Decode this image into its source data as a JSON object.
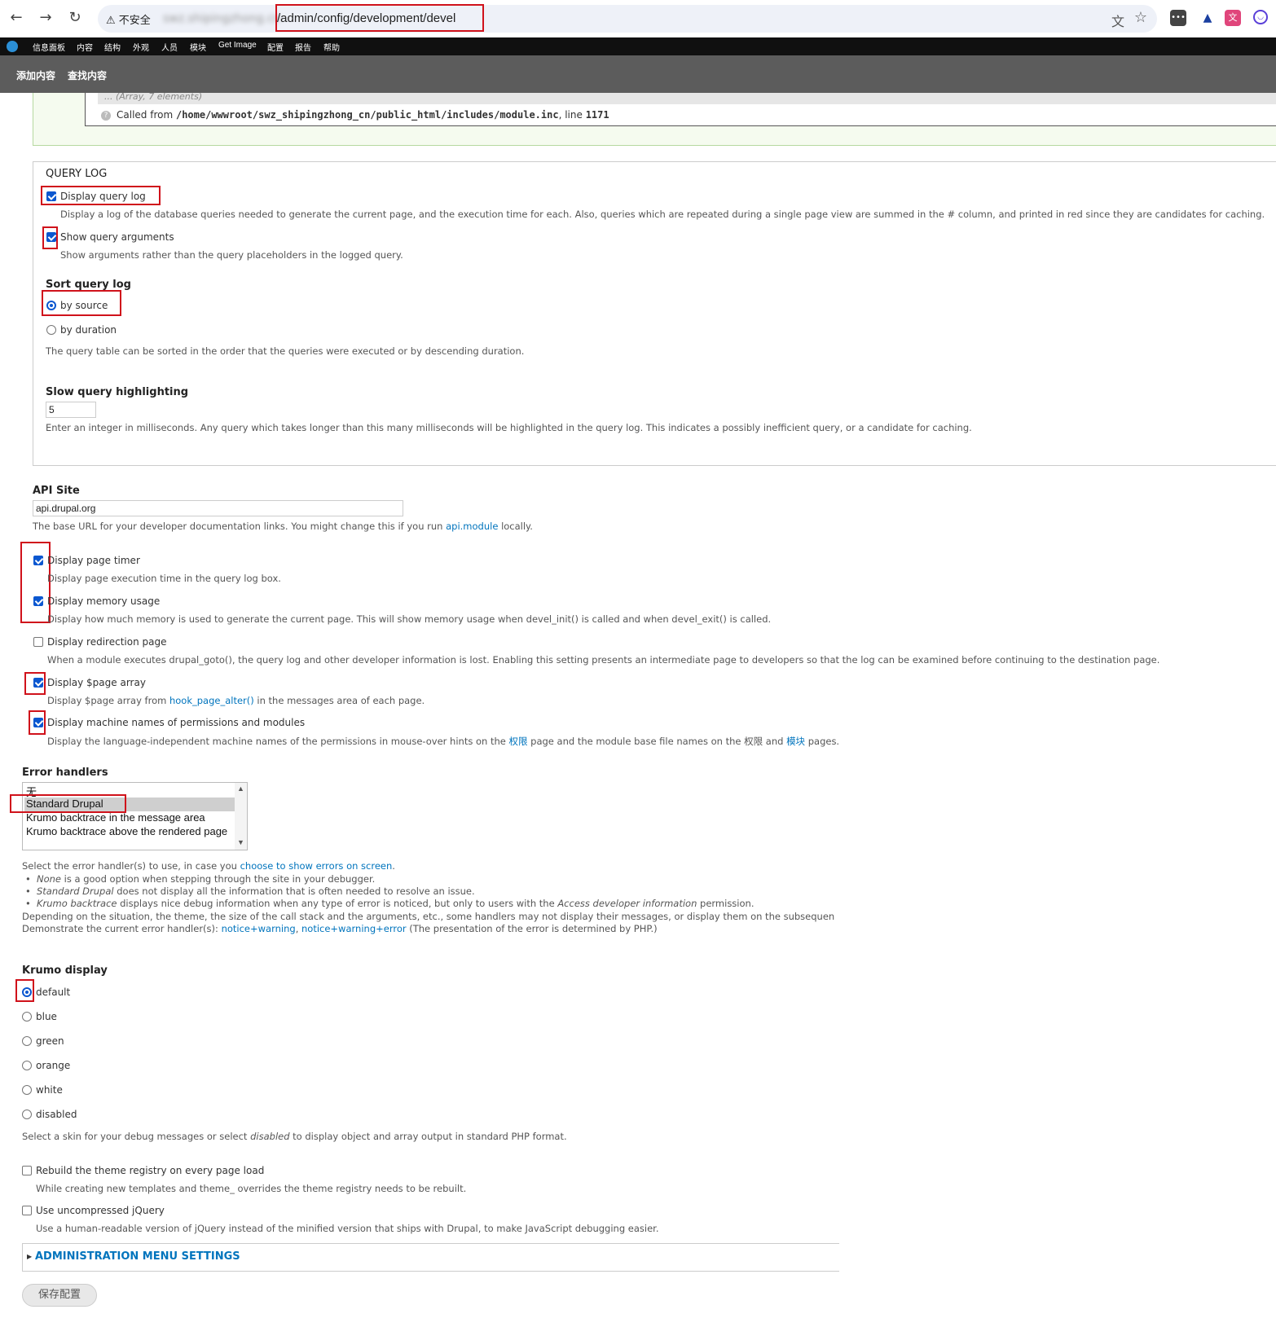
{
  "browser": {
    "insecure_label": "不安全",
    "host": "swz.shipingzhong.cn",
    "path": "/admin/config/development/devel",
    "back_icon": "←",
    "forward_icon": "→",
    "reload_icon": "↻"
  },
  "toolbar": {
    "items": [
      "信息面板",
      "内容",
      "结构",
      "外观",
      "人员",
      "模块",
      "Get Image",
      "配置",
      "报告",
      "帮助"
    ]
  },
  "shortcuts": {
    "add": "添加内容",
    "find": "查找内容"
  },
  "krumo_tail": {
    "array_label": "... (Array, 7 elements)",
    "called_from": "Called from",
    "file": "/home/wwwroot/swz_shipingzhong_cn/public_html/includes/module.inc",
    "line_label": ", line",
    "line": "1171"
  },
  "query_log": {
    "legend": "QUERY LOG",
    "display_label": "Display query log",
    "display_desc": "Display a log of the database queries needed to generate the current page, and the execution time for each. Also, queries which are repeated during a single page view are summed in the # column, and printed in red since they are candidates for caching.",
    "args_label": "Show query arguments",
    "args_desc": "Show arguments rather than the query placeholders in the logged query.",
    "sort_title": "Sort query log",
    "sort_source": "by source",
    "sort_duration": "by duration",
    "sort_desc": "The query table can be sorted in the order that the queries were executed or by descending duration.",
    "slow_title": "Slow query highlighting",
    "slow_value": "5",
    "slow_desc": "Enter an integer in milliseconds. Any query which takes longer than this many milliseconds will be highlighted in the query log. This indicates a possibly inefficient query, or a candidate for caching."
  },
  "api": {
    "title": "API Site",
    "value": "api.drupal.org",
    "desc_pre": "The base URL for your developer documentation links. You might change this if you run",
    "desc_link": "api.module",
    "desc_post": "locally."
  },
  "options": {
    "timer_label": "Display page timer",
    "timer_desc": "Display page execution time in the query log box.",
    "memory_label": "Display memory usage",
    "memory_desc": "Display how much memory is used to generate the current page. This will show memory usage when devel_init() is called and when devel_exit() is called.",
    "redirect_label": "Display redirection page",
    "redirect_desc": "When a module executes drupal_goto(), the query log and other developer information is lost. Enabling this setting presents an intermediate page to developers so that the log can be examined before continuing to the destination page.",
    "page_array_label": "Display $page array",
    "page_array_desc_pre": "Display $page array from",
    "page_array_desc_link": "hook_page_alter()",
    "page_array_desc_post": "in the messages area of each page.",
    "machine_label": "Display machine names of permissions and modules",
    "machine_desc_pre": "Display the language-independent machine names of the permissions in mouse-over hints on the",
    "machine_link1": "权限",
    "machine_desc_mid": "page and the module base file names on the 权限 and",
    "machine_link2": "模块",
    "machine_desc_post": "pages."
  },
  "error_handlers": {
    "title": "Error handlers",
    "options": [
      "无",
      "Standard Drupal",
      "Krumo backtrace in the message area",
      "Krumo backtrace above the rendered page"
    ],
    "selected": "Standard Drupal",
    "desc_pre": "Select the error handler(s) to use, in case you",
    "desc_link": "choose to show errors on screen",
    "desc_post": ".",
    "bullet1_em": "None",
    "bullet1": "is a good option when stepping through the site in your debugger.",
    "bullet2_em": "Standard Drupal",
    "bullet2": "does not display all the information that is often needed to resolve an issue.",
    "bullet3_em": "Krumo backtrace",
    "bullet3": "displays nice debug information when any type of error is noticed, but only to users with the",
    "bullet3_em2": "Access developer information",
    "bullet3_post": "permission.",
    "depending": "Depending on the situation, the theme, the size of the call stack and the arguments, etc., some handlers may not display their messages, or display them on the subsequen",
    "demo_pre": "Demonstrate the current error handler(s):",
    "demo_link1": "notice+warning",
    "demo_sep": ",",
    "demo_link2": "notice+warning+error",
    "demo_post": "(The presentation of the error is determined by PHP.)"
  },
  "krumo": {
    "title": "Krumo display",
    "options": [
      "default",
      "blue",
      "green",
      "orange",
      "white",
      "disabled"
    ],
    "selected": "default",
    "desc_pre": "Select a skin for your debug messages or select",
    "desc_em": "disabled",
    "desc_post": "to display object and array output in standard PHP format."
  },
  "rebuild": {
    "label": "Rebuild the theme registry on every page load",
    "desc": "While creating new templates and theme_ overrides the theme registry needs to be rebuilt."
  },
  "jquery": {
    "label": "Use uncompressed jQuery",
    "desc": "Use a human-readable version of jQuery instead of the minified version that ships with Drupal, to make JavaScript debugging easier."
  },
  "admin_menu": {
    "title": "ADMINISTRATION MENU SETTINGS"
  },
  "save_label": "保存配置",
  "colors": {
    "accent": "#0b57d0",
    "link": "#0074bd",
    "annotation": "#d0121b"
  }
}
